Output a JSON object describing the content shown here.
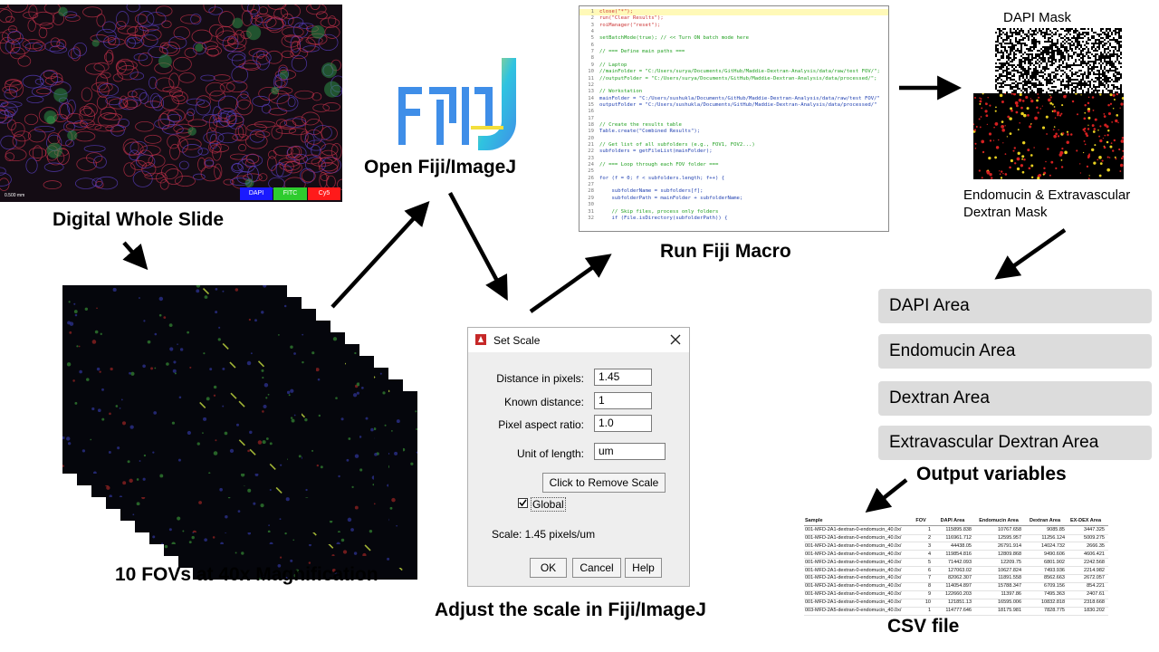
{
  "slide": {
    "caption": "Digital Whole Slide",
    "scale_text": "0.500 mm",
    "channels": [
      {
        "label": "DAPI",
        "color": "#1a1aff"
      },
      {
        "label": "FITC",
        "color": "#2ecc2e"
      },
      {
        "label": "Cy5",
        "color": "#ff1a1a"
      }
    ]
  },
  "fov": {
    "caption": "10 FOVs at 40x Magnification"
  },
  "fiji": {
    "caption": "Open Fiji/ImageJ"
  },
  "macro": {
    "caption": "Run Fiji Macro",
    "lines": [
      {
        "n": "1",
        "text": "close(\"*\");",
        "color": "#cc3333",
        "highlight": true
      },
      {
        "n": "2",
        "text": "run(\"Clear Results\");",
        "color": "#cc3333"
      },
      {
        "n": "3",
        "text": "roiManager(\"reset\");",
        "color": "#cc3333"
      },
      {
        "n": "4",
        "text": "",
        "color": "#000"
      },
      {
        "n": "5",
        "text": "setBatchMode(true); // << Turn ON batch mode here",
        "color": "#22a022"
      },
      {
        "n": "6",
        "text": "",
        "color": "#000"
      },
      {
        "n": "7",
        "text": "// === Define main paths ===",
        "color": "#22a022"
      },
      {
        "n": "8",
        "text": "",
        "color": "#000"
      },
      {
        "n": "9",
        "text": "// Laptop",
        "color": "#22a022"
      },
      {
        "n": "10",
        "text": "//mainFolder = \"C:/Users/surya/Documents/GitHub/Maddie-Dextran-Analysis/data/raw/test FOV/\";",
        "color": "#22a022"
      },
      {
        "n": "11",
        "text": "//outputFolder = \"C:/Users/surya/Documents/GitHub/Maddie-Dextran-Analysis/data/processed/\";",
        "color": "#22a022"
      },
      {
        "n": "12",
        "text": "",
        "color": "#000"
      },
      {
        "n": "13",
        "text": "// Workstation",
        "color": "#22a022"
      },
      {
        "n": "14",
        "text": "mainFolder = \"C:/Users/sushukla/Documents/GitHub/Maddie-Dextran-Analysis/data/raw/test FOV/\"",
        "color": "#1f3fb0"
      },
      {
        "n": "15",
        "text": "outputFolder = \"C:/Users/sushukla/Documents/GitHub/Maddie-Dextran-Analysis/data/processed/\"",
        "color": "#1f3fb0"
      },
      {
        "n": "16",
        "text": "",
        "color": "#000"
      },
      {
        "n": "17",
        "text": "",
        "color": "#000"
      },
      {
        "n": "18",
        "text": "// Create the results table",
        "color": "#22a022"
      },
      {
        "n": "19",
        "text": "Table.create(\"Combined Results\");",
        "color": "#1f3fb0"
      },
      {
        "n": "20",
        "text": "",
        "color": "#000"
      },
      {
        "n": "21",
        "text": "// Get list of all subfolders (e.g., FOV1, FOV2...)",
        "color": "#22a022"
      },
      {
        "n": "22",
        "text": "subfolders = getFileList(mainFolder);",
        "color": "#1f3fb0"
      },
      {
        "n": "23",
        "text": "",
        "color": "#000"
      },
      {
        "n": "24",
        "text": "// === Loop through each FOV folder ===",
        "color": "#22a022"
      },
      {
        "n": "25",
        "text": "",
        "color": "#000"
      },
      {
        "n": "26",
        "text": "for (f = 0; f < subfolders.length; f++) {",
        "color": "#1f3fb0"
      },
      {
        "n": "27",
        "text": "",
        "color": "#000"
      },
      {
        "n": "28",
        "text": "    subfolderName = subfolders[f];",
        "color": "#1f3fb0"
      },
      {
        "n": "29",
        "text": "    subfolderPath = mainFolder + subfolderName;",
        "color": "#1f3fb0"
      },
      {
        "n": "30",
        "text": "",
        "color": "#000"
      },
      {
        "n": "31",
        "text": "    // Skip files, process only folders",
        "color": "#22a022"
      },
      {
        "n": "32",
        "text": "    if (File.isDirectory(subfolderPath)) {",
        "color": "#1f3fb0"
      }
    ]
  },
  "masks": {
    "dapi_label": "DAPI Mask",
    "endo_label": "Endomucin & Extravascular Dextran Mask"
  },
  "dialog": {
    "title": "Set Scale",
    "fields": [
      {
        "label": "Distance in pixels:",
        "value": "1.45"
      },
      {
        "label": "Known distance:",
        "value": "1"
      },
      {
        "label": "Pixel aspect ratio:",
        "value": "1.0"
      },
      {
        "label": "Unit of length:",
        "value": "um"
      }
    ],
    "remove_button": "Click to Remove Scale",
    "global_label": "Global",
    "global_checked": true,
    "scale_text": "Scale: 1.45 pixels/um",
    "ok": "OK",
    "cancel": "Cancel",
    "help": "Help",
    "caption": "Adjust the scale in Fiji/ImageJ"
  },
  "outputs": {
    "variables": [
      "DAPI Area",
      "Endomucin Area",
      "Dextran Area",
      "Extravascular Dextran Area"
    ],
    "caption": "Output variables"
  },
  "csv": {
    "caption": "CSV file",
    "headers": [
      "Sample",
      "FOV",
      "DAPI Area",
      "Endomucin Area",
      "Dextran Area",
      "EX-DEX Area"
    ],
    "rows": [
      [
        "001-MFD-2A1-dextran-0-endomucin_40.0x/",
        "1",
        "115895.838",
        "10767.658",
        "9085.85",
        "3447.325"
      ],
      [
        "001-MFD-2A1-dextran-0-endomucin_40.0x/",
        "2",
        "116961.712",
        "12595.957",
        "11256.124",
        "5009.275"
      ],
      [
        "001-MFD-2A1-dextran-0-endomucin_40.0x/",
        "3",
        "44438.05",
        "26791.914",
        "14024.732",
        "2666.35"
      ],
      [
        "001-MFD-2A1-dextran-0-endomucin_40.0x/",
        "4",
        "119854.816",
        "12809.868",
        "9490.606",
        "4606.421"
      ],
      [
        "001-MFD-2A1-dextran-0-endomucin_40.0x/",
        "5",
        "71442.093",
        "12209.75",
        "6801.902",
        "2242.568"
      ],
      [
        "001-MFD-2A1-dextran-0-endomucin_40.0x/",
        "6",
        "127063.02",
        "10627.824",
        "7493.936",
        "2214.982"
      ],
      [
        "001-MFD-2A1-dextran-0-endomucin_40.0x/",
        "7",
        "82062.307",
        "11891.558",
        "8562.663",
        "2672.057"
      ],
      [
        "001-MFD-2A1-dextran-0-endomucin_40.0x/",
        "8",
        "114054.897",
        "15788.347",
        "6709.156",
        "854.221"
      ],
      [
        "001-MFD-2A1-dextran-0-endomucin_40.0x/",
        "9",
        "122660.203",
        "11397.86",
        "7495.363",
        "2407.61"
      ],
      [
        "001-MFD-2A1-dextran-0-endomucin_40.0x/",
        "10",
        "121851.13",
        "16595.006",
        "10832.818",
        "2318.668"
      ],
      [
        "003-MFD-2A5-dextran-0-endomucin_40.0x/",
        "1",
        "114777.646",
        "18175.981",
        "7828.775",
        "1830.202"
      ]
    ]
  },
  "colors": {
    "fiji_blue": "#3f8ee8",
    "fiji_cyan": "#2fc3e0",
    "fiji_yellow": "#f3df3c",
    "variable_box": "#dcdcdc"
  }
}
